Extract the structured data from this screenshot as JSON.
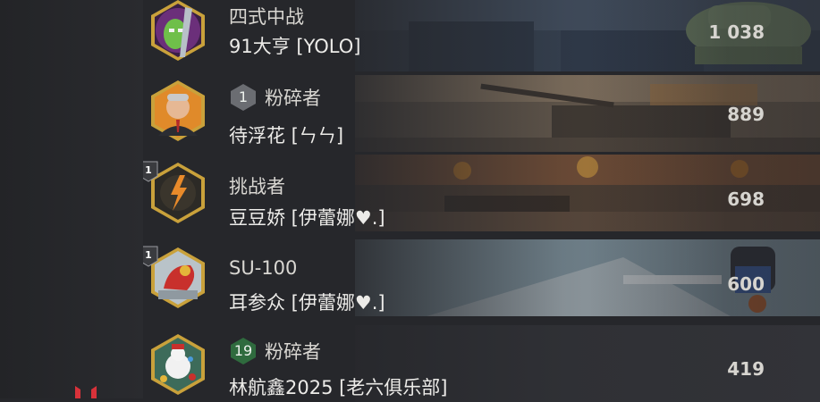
{
  "rows": [
    {
      "title": "四式中战",
      "player": "91大亨 [YOLO]",
      "score": "1 038",
      "title_badge": "",
      "rank": ""
    },
    {
      "title": "粉碎者",
      "player": "待浮花 [ㄣㄣ]",
      "score": "889",
      "title_badge": "1",
      "rank": ""
    },
    {
      "title": "挑战者",
      "player": "豆豆娇 [伊蕾娜♥.]",
      "score": "698",
      "title_badge": "",
      "rank": "1"
    },
    {
      "title": "SU-100",
      "player": "耳参众 [伊蕾娜♥.]",
      "score": "600",
      "title_badge": "",
      "rank": "1"
    },
    {
      "title": "粉碎者",
      "player": "林航鑫2025 [老六俱乐部]",
      "score": "419",
      "title_badge": "19",
      "rank": ""
    }
  ],
  "colors": {
    "avatar_frame": "#c9a13b",
    "badge_gray": "#6b6d72",
    "badge_green": "#2f6b3e",
    "brand_red": "#d8323a"
  },
  "icons": [
    "medal-icon",
    "rank-badge-icon",
    "brand-logo-icon"
  ]
}
